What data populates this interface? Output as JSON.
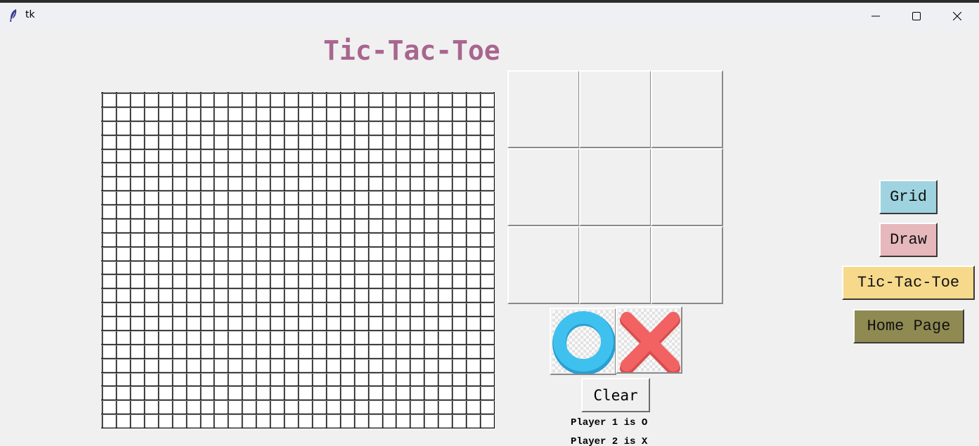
{
  "window": {
    "title": "tk",
    "controls": {
      "minimize": "minimize-icon",
      "maximize": "maximize-icon",
      "close": "close-icon"
    }
  },
  "app": {
    "title": "Tic-Tac-Toe",
    "title_color": "#a8668f"
  },
  "drawing_grid": {
    "columns": 28,
    "rows": 24
  },
  "board": {
    "cells": [
      "",
      "",
      "",
      "",
      "",
      "",
      "",
      "",
      ""
    ]
  },
  "pieces": {
    "o": {
      "icon": "o-piece-icon",
      "color": "#3ec1ef"
    },
    "x": {
      "icon": "x-piece-icon",
      "color": "#f26262"
    }
  },
  "controls": {
    "clear_label": "Clear",
    "player1_text": "Player 1 is O",
    "player2_text": "Player 2 is X"
  },
  "menu": {
    "grid": {
      "label": "Grid",
      "color": "#9ed3df"
    },
    "draw": {
      "label": "Draw",
      "color": "#e6b8bc"
    },
    "tictactoe": {
      "label": "Tic-Tac-Toe",
      "color": "#f6d98a"
    },
    "home": {
      "label": "Home Page",
      "color": "#8f8a52"
    }
  }
}
